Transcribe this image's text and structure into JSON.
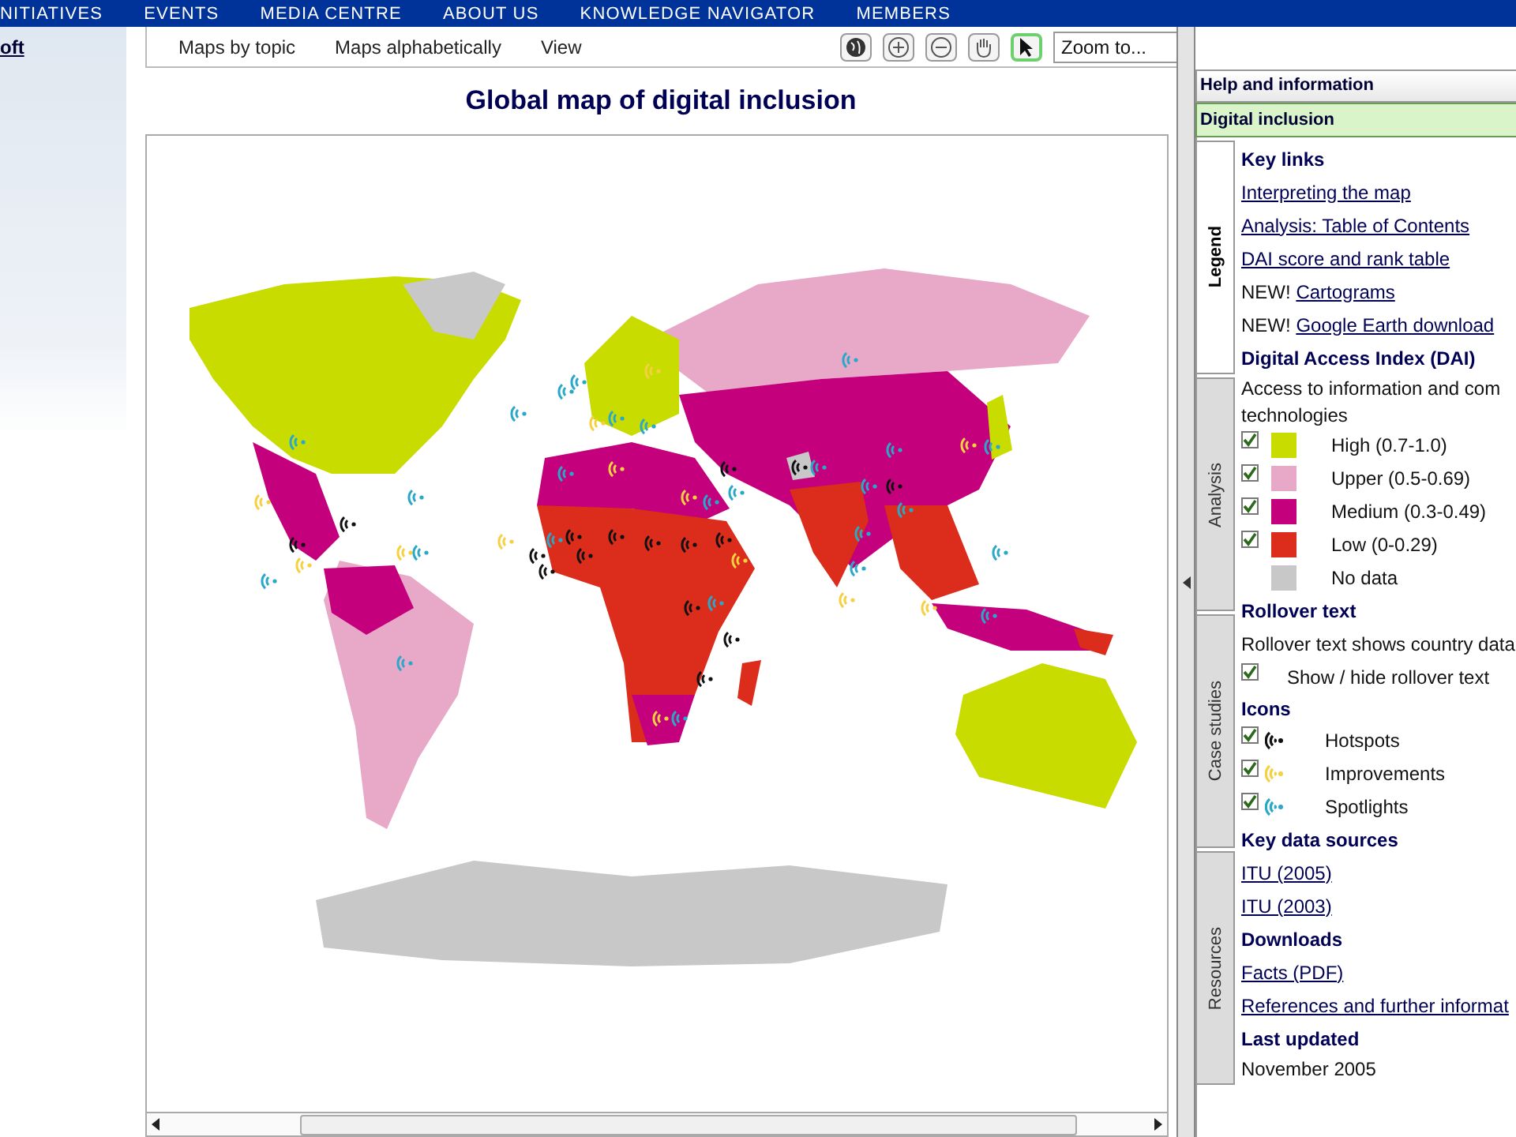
{
  "top_nav": [
    {
      "label": "NITIATIVES"
    },
    {
      "label": "EVENTS"
    },
    {
      "label": "MEDIA CENTRE"
    },
    {
      "label": "ABOUT US"
    },
    {
      "label": "KNOWLEDGE NAVIGATOR"
    },
    {
      "label": "MEMBERS"
    }
  ],
  "left_column": {
    "link": "oft"
  },
  "toolbar": {
    "menus": [
      "Maps by topic",
      "Maps alphabetically",
      "View"
    ],
    "tools": [
      {
        "kind": "globe",
        "selected": false
      },
      {
        "kind": "zoom-in",
        "selected": false
      },
      {
        "kind": "zoom-out",
        "selected": false
      },
      {
        "kind": "pan",
        "selected": false
      },
      {
        "kind": "pointer",
        "selected": true
      }
    ],
    "zoom_field": {
      "value": "Zoom to..."
    }
  },
  "map": {
    "title": "Global map of digital inclusion"
  },
  "side_panel": {
    "header": "Help and information",
    "section": "Digital inclusion",
    "tabs": [
      {
        "label": "Legend",
        "selected": true
      },
      {
        "label": "Analysis",
        "selected": false
      },
      {
        "label": "Case studies",
        "selected": false
      },
      {
        "label": "Resources",
        "selected": false
      }
    ],
    "key_links": {
      "heading": "Key links",
      "items": [
        {
          "label": "Interpreting the map"
        },
        {
          "label": "Analysis: Table of Contents"
        },
        {
          "label": "DAI score and rank table"
        },
        {
          "prefix": "NEW!",
          "label": "Cartograms"
        },
        {
          "prefix": "NEW!",
          "label": "Google Earth download"
        }
      ]
    },
    "dai": {
      "heading": "Digital Access Index (DAI)",
      "desc_lines": [
        "Access to information and com",
        "technologies"
      ],
      "levels": [
        {
          "kind": "checkbox",
          "checked": true,
          "color": "#c8dc00",
          "label": "High (0.7-1.0)"
        },
        {
          "kind": "checkbox",
          "checked": true,
          "color": "#e8a8c8",
          "label": "Upper (0.5-0.69)"
        },
        {
          "kind": "checkbox",
          "checked": true,
          "color": "#c4007c",
          "label": "Medium (0.3-0.49)"
        },
        {
          "kind": "checkbox",
          "checked": true,
          "color": "#dc2c1c",
          "label": "Low (0-0.29)"
        },
        {
          "kind": "plain",
          "color": "#c8c8c8",
          "label": "No data"
        }
      ]
    },
    "rollover": {
      "heading": "Rollover text",
      "text": "Rollover text shows country data",
      "toggle": {
        "label": "Show / hide rollover text",
        "checked": true
      }
    },
    "icons": {
      "heading": "Icons",
      "items": [
        {
          "label": "Hotspots",
          "color": "#111111",
          "checked": true
        },
        {
          "label": "Improvements",
          "color": "#f5d040",
          "checked": true
        },
        {
          "label": "Spotlights",
          "color": "#2aa8c8",
          "checked": true
        }
      ]
    },
    "data_sources": {
      "heading": "Key data sources",
      "links": [
        "ITU (2005)",
        "ITU (2003)"
      ]
    },
    "downloads": {
      "heading": "Downloads",
      "links": [
        "Facts (PDF)",
        "References and further informat"
      ]
    },
    "last_updated": {
      "heading": "Last updated",
      "value": "November 2005"
    }
  }
}
